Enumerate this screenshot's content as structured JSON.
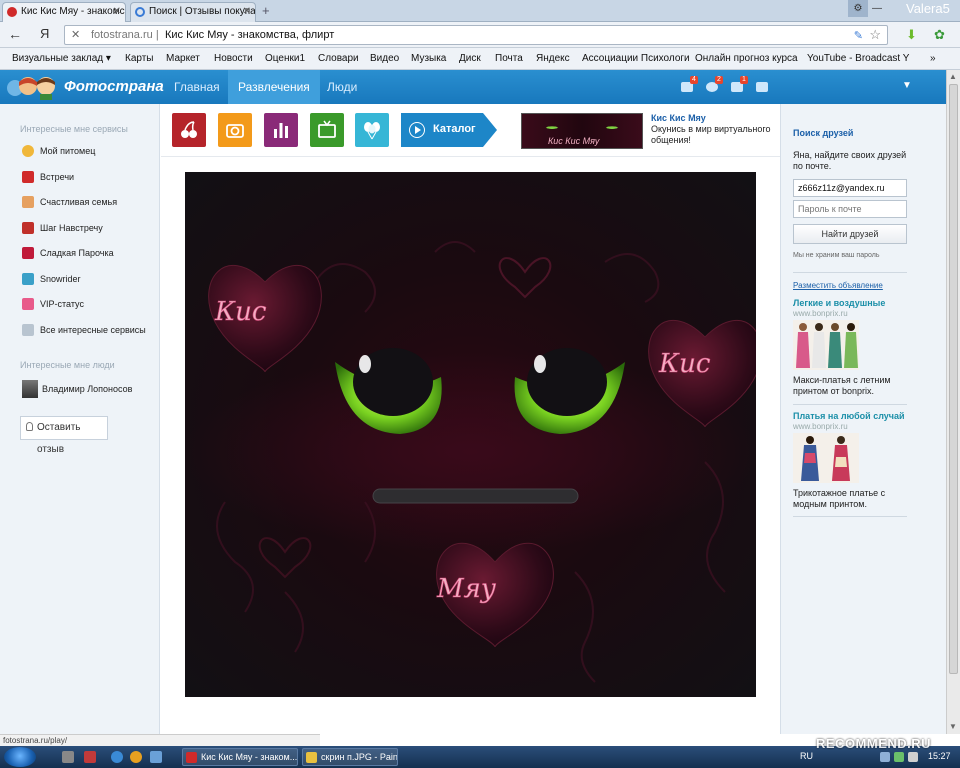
{
  "browser": {
    "tabs": [
      {
        "label": "Кис Кис Мяу - знакомс",
        "close": "✕"
      },
      {
        "label": "Поиск | Отзывы покупа",
        "close": "✕"
      }
    ],
    "new_tab": "+",
    "user_name": "Valera5",
    "url": {
      "clear": "✕",
      "domain": "fotostrana.ru",
      "sep": "|",
      "page_title": "Кис Кис Мяу - знакомства, флирт"
    },
    "back": "←",
    "ya": "Я",
    "bookmarks": [
      "Визуальные заклад ▾",
      "Карты",
      "Маркет",
      "Новости",
      "Оценки1",
      "Словари",
      "Видео",
      "Музыка",
      "Диск",
      "Почта",
      "Яндекс",
      "Ассоциации Психологи",
      "Онлайн прогноз курса",
      "YouTube - Broadcast Y",
      "»"
    ]
  },
  "site": {
    "logo_word": "Фотострана",
    "nav": [
      "Главная",
      "Развлечения",
      "Люди"
    ],
    "badges": [
      "4",
      "2",
      "1"
    ],
    "menu_arrow": "▼"
  },
  "left": {
    "services_head": "Интересные мне сервисы",
    "services": [
      {
        "label": "Мой питомец",
        "color": "#f0b73a"
      },
      {
        "label": "Встречи",
        "color": "#d02a2a"
      },
      {
        "label": "Счастливая семья",
        "color": "#e6a060"
      },
      {
        "label": "Шаг Навстречу",
        "color": "#c0302a"
      },
      {
        "label": "Сладкая Парочка",
        "color": "#c01a3a"
      },
      {
        "label": "Snowrider",
        "color": "#3aa0c8"
      },
      {
        "label": "VIP-статус",
        "color": "#e85a8a"
      },
      {
        "label": "Все интересные сервисы",
        "color": "#b8c4d0"
      }
    ],
    "people_head": "Интересные мне люди",
    "person": "Владимир Лопоносов",
    "feedback": "Оставить отзыв"
  },
  "center": {
    "game_icons": [
      {
        "name": "cherry",
        "color": "#b5242a"
      },
      {
        "name": "camera",
        "color": "#f39a1a"
      },
      {
        "name": "chart",
        "color": "#8a2a78"
      },
      {
        "name": "tv",
        "color": "#3a9a2a"
      },
      {
        "name": "balloons",
        "color": "#36b6d6"
      }
    ],
    "catalog": "Каталог",
    "promo_title": "Кис Кис Мяу",
    "promo_desc": "Окунись в мир виртуального общения!",
    "promo_thumb_text": "Кис Кис Мяу",
    "game_text_1": "Кис",
    "game_text_2": "Кис",
    "game_text_3": "Мяу"
  },
  "right": {
    "search_title": "Поиск друзей",
    "search_desc": "Яна, найдите своих друзей по почте.",
    "email_value": "z666z11z@yandex.ru",
    "password_placeholder": "Пароль к почте",
    "find_button": "Найти друзей",
    "note": "Мы не храним ваш пароль",
    "place_ad": "Разместить объявление",
    "ad1_title": "Легкие и воздушные",
    "ad1_url": "www.bonprix.ru",
    "ad1_text": "Макси-платья с летним принтом от bonprix.",
    "ad2_title": "Платья на любой случай",
    "ad2_url": "www.bonprix.ru",
    "ad2_text": "Трикотажное платье с модным принтом."
  },
  "status_text": "fotostrana.ru/play/",
  "taskbar": {
    "tasks": [
      "Кис Кис Мяу - знаком...",
      "скрин п.JPG - Paint"
    ],
    "lang": "RU",
    "time": "15:27"
  },
  "watermark": "RECOMMEND.RU"
}
